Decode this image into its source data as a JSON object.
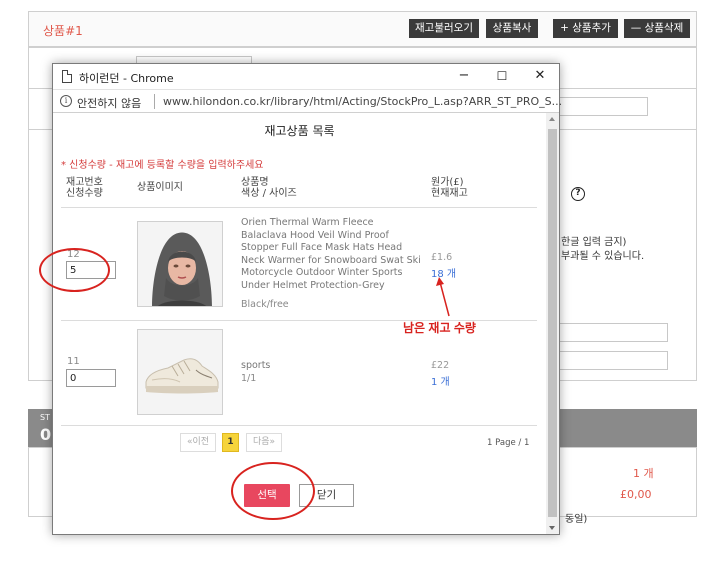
{
  "background": {
    "product_title": "상품#1",
    "buttons": [
      "재고불러오기",
      "상품복사",
      "+ 상품추가",
      "— 상품삭제"
    ],
    "text_korean_input": "한글 입력 금지)",
    "text_charge": "부과될 수 있습니다.",
    "text_st": "ST",
    "text_zero": "0",
    "qty_label": "1 개",
    "price_label": "£0,00",
    "text_same": "동일)"
  },
  "window": {
    "title": "하이런던 - Chrome",
    "minimize": "−",
    "maximize": "☐",
    "close": "✕",
    "insecure_label": "안전하지 않음",
    "url": "www.hilondon.co.kr/library/html/Acting/StockPro_L.asp?ARR_ST_PRO_S..."
  },
  "popup": {
    "title": "재고상품 목록",
    "notice": "* 신청수량 - 재고에 등록할 수량을 입력하주세요",
    "headers": {
      "stock_no": "재고번호\n신청수량",
      "image": "상품이미지",
      "name": "상품명\n색상 / 사이즈",
      "price": "원가(£)\n현재재고"
    },
    "rows": [
      {
        "stock_no": "12",
        "qty": "5",
        "name": "Orien Thermal Warm Fleece Balaclava Hood Veil Wind Proof Stopper Full Face Mask Hats Head Neck Warmer for Snowboard Swat Ski Motorcycle Outdoor Winter Sports Under Helmet Protection-Grey",
        "option": "Black/free",
        "price": "£1.6",
        "stock": "18 개"
      },
      {
        "stock_no": "11",
        "qty": "0",
        "name": "sports",
        "option": "1/1",
        "price": "£22",
        "stock": "1 개"
      }
    ],
    "pagination": {
      "prev": "«이전",
      "current": "1",
      "next": "다음»",
      "info": "1 Page / 1"
    },
    "select_button": "선택",
    "close_button": "닫기"
  },
  "annotation": {
    "label": "남은 재고 수량",
    "color": "#d8231f"
  }
}
